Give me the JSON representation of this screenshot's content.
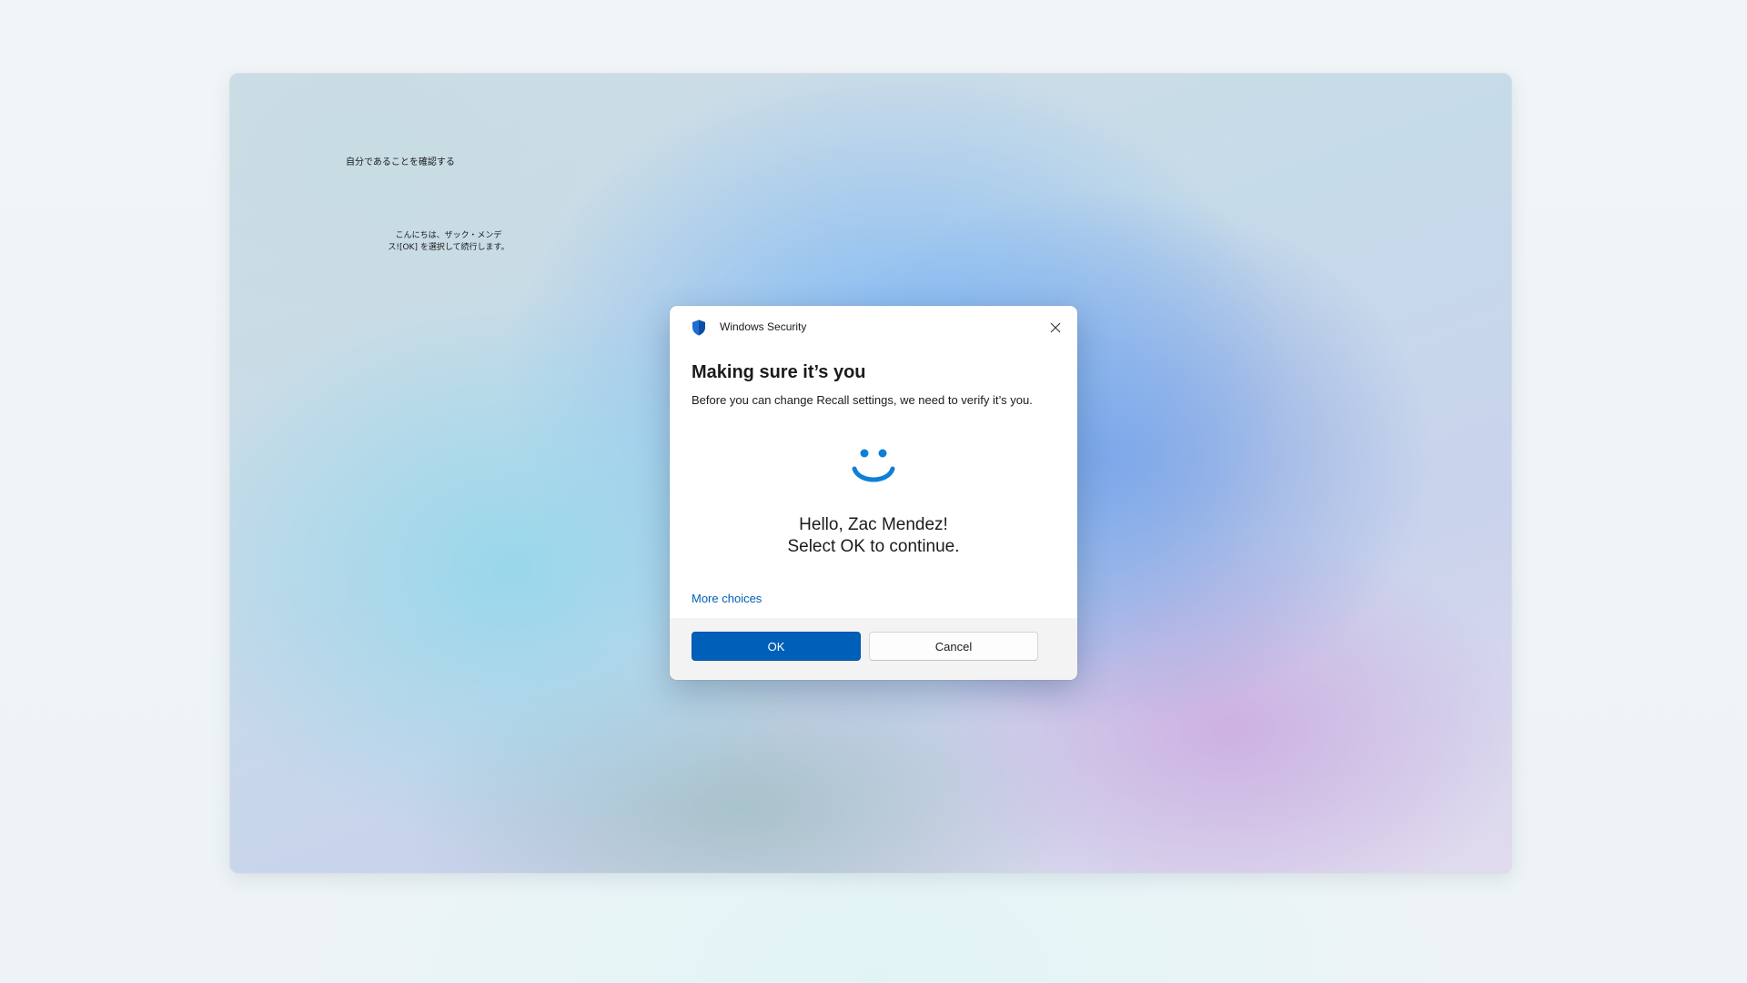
{
  "background_text": {
    "title": "自分であることを確認する",
    "message_line1": "こんにちは、ザック・メンデ",
    "message_line2": "ス![OK] を選択して続行します。"
  },
  "dialog": {
    "app_title": "Windows Security",
    "heading": "Making sure it’s you",
    "subtext": "Before you can change Recall settings, we need to verify it’s you.",
    "greeting_line1": "Hello, Zac Mendez!",
    "greeting_line2": "Select OK to continue.",
    "more_choices": "More choices",
    "ok_label": "OK",
    "cancel_label": "Cancel",
    "icons": {
      "title_icon": "shield-icon",
      "close_icon": "close-icon",
      "face_icon": "windows-hello-face-icon"
    },
    "colors": {
      "accent": "#005fb8",
      "face": "#0f7fd6"
    }
  }
}
